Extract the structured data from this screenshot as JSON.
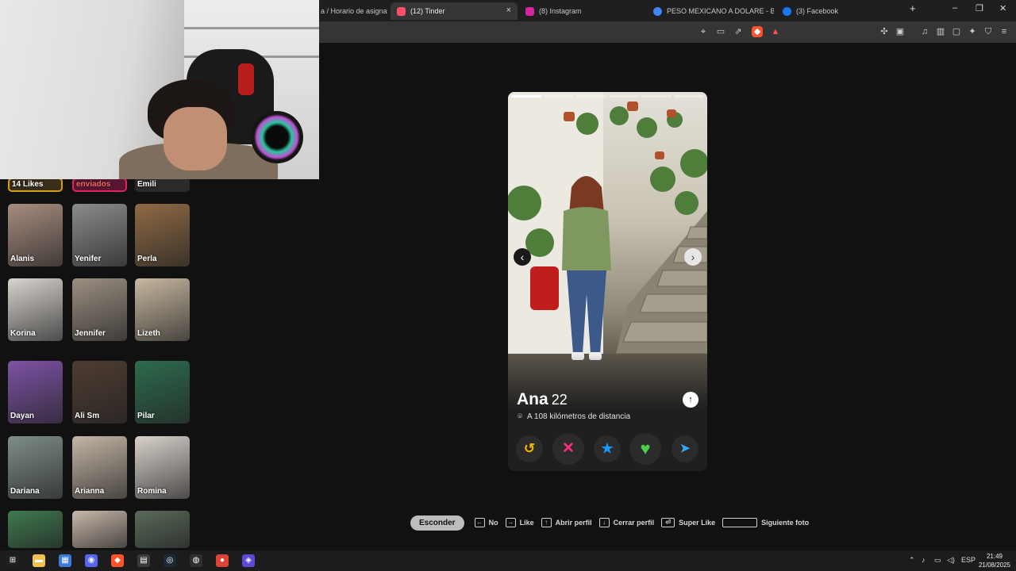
{
  "browser": {
    "tabs": [
      {
        "label": "a / Horario de asignat",
        "active": false,
        "favicon_color": "#2b6cb0"
      },
      {
        "label": "(12) Tinder",
        "active": true,
        "favicon_color": "#fd5068"
      },
      {
        "label": "(8) Instagram",
        "active": false,
        "favicon_color": "#d6249f"
      },
      {
        "label": "PESO MEXICANO A DOLARE - Busca",
        "active": false,
        "favicon_color": "#4285f4"
      },
      {
        "label": "(3) Facebook",
        "active": false,
        "favicon_color": "#1877f2"
      }
    ],
    "new_tab": "+",
    "close_tab": "×",
    "window_controls": {
      "minimize": "–",
      "restore": "❐",
      "close": "✕"
    },
    "toolbar_icons": [
      "location-icon",
      "cast-icon",
      "share-icon",
      "brave-shield-icon",
      "brave-rewards-icon",
      "extensions-icon",
      "screenshot-icon",
      "music-icon",
      "sidebar-icon",
      "wallet-icon",
      "leo-ai-icon",
      "vpn-icon",
      "menu-icon"
    ]
  },
  "left_panel": {
    "top_row": [
      {
        "label": "14 Likes",
        "border": "#d4a017"
      },
      {
        "label": "enviados",
        "border": "#e0245e"
      },
      {
        "label": "Emili"
      }
    ],
    "matches": [
      {
        "name": "Alanis",
        "tone": "#a88d80"
      },
      {
        "name": "Yenifer",
        "tone": "#8c8c8c"
      },
      {
        "name": "Perla",
        "tone": "#8f6a44"
      },
      {
        "name": "Korina",
        "tone": "#d8d4cf"
      },
      {
        "name": "Jennifer",
        "tone": "#9b8f82"
      },
      {
        "name": "Lizeth",
        "tone": "#c7b8a0"
      },
      {
        "name": "Dayan",
        "tone": "#7d52a5"
      },
      {
        "name": "Ali Sm",
        "tone": "#4e3c32"
      },
      {
        "name": "Pilar",
        "tone": "#2d6b4d"
      },
      {
        "name": "Dariana",
        "tone": "#7f8d8a"
      },
      {
        "name": "Arianna",
        "tone": "#c4b6a6"
      },
      {
        "name": "Romina",
        "tone": "#d9d2cc"
      },
      {
        "name": "",
        "tone": "#3f7a4f"
      },
      {
        "name": "",
        "tone": "#c9b9ab"
      },
      {
        "name": "",
        "tone": "#5a6a5a"
      }
    ]
  },
  "profile": {
    "name": "Ana",
    "age": "22",
    "distance": "A 108 kilómetros de distancia",
    "photo_count": 6,
    "prev_arrow": "‹",
    "next_arrow": "›",
    "info_icon": "↑",
    "actions": [
      {
        "name": "rewind-button",
        "glyph": "↺",
        "color": "#f5b800"
      },
      {
        "name": "nope-button",
        "glyph": "✕",
        "color": "#ff2e7e"
      },
      {
        "name": "super-like-button",
        "glyph": "★",
        "color": "#1a9bfc"
      },
      {
        "name": "like-button",
        "glyph": "♥",
        "color": "#4ccd4c"
      },
      {
        "name": "boost-button",
        "glyph": "➤",
        "color": "#3aa4f4"
      }
    ]
  },
  "shortcuts": {
    "hide_button": "Esconder",
    "items": [
      {
        "key": "←",
        "label": "No"
      },
      {
        "key": "→",
        "label": "Like"
      },
      {
        "key": "↑",
        "label": "Abrir perfil"
      },
      {
        "key": "↓",
        "label": "Cerrar perfil"
      },
      {
        "key": "⏎",
        "label": "Super Like"
      },
      {
        "key": "",
        "label": "Siguiente foto",
        "wide": true
      }
    ]
  },
  "taskbar": {
    "apps": [
      {
        "name": "windows-start-icon",
        "glyph": "⊞",
        "color": "#1f1f1f"
      },
      {
        "name": "file-explorer-icon",
        "glyph": "▬",
        "color": "#f2c14e"
      },
      {
        "name": "microsoft-store-icon",
        "glyph": "▦",
        "color": "#3d7bd9"
      },
      {
        "name": "discord-icon",
        "glyph": "◉",
        "color": "#5865f2"
      },
      {
        "name": "brave-icon",
        "glyph": "◆",
        "color": "#fb542b"
      },
      {
        "name": "calculator-icon",
        "glyph": "▤",
        "color": "#3b3b3b"
      },
      {
        "name": "steam-icon",
        "glyph": "◎",
        "color": "#1b2838"
      },
      {
        "name": "obs-icon",
        "glyph": "◍",
        "color": "#302e31"
      },
      {
        "name": "chrome-icon",
        "glyph": "●",
        "color": "#db4437"
      },
      {
        "name": "app-icon",
        "glyph": "◈",
        "color": "#5b4bd6"
      }
    ],
    "language": "ESP",
    "time": "21:49",
    "date": "21/08/2025"
  }
}
